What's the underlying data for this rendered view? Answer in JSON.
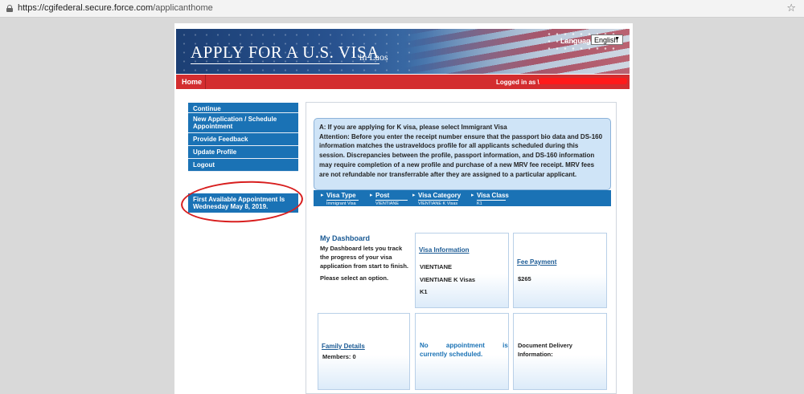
{
  "browser": {
    "url_host": "https://cgifederal.secure.force.com",
    "url_path": "/applicanthome"
  },
  "header": {
    "title": "APPLY FOR A U.S. VISA",
    "country": "in  Laos",
    "language_label": "Language:",
    "language_value": "English"
  },
  "navbar": {
    "home": "Home",
    "logged_in": "Logged in as  \\"
  },
  "sidebar": {
    "items": [
      {
        "label": "Continue"
      },
      {
        "label": "New Application / Schedule Appointment"
      },
      {
        "label": "Provide Feedback"
      },
      {
        "label": "Update Profile"
      },
      {
        "label": "Logout"
      }
    ],
    "appointment": "First Available Appointment Is Wednesday May 8, 2019."
  },
  "notice": {
    "line1": "A: If you are applying for K visa, please select Immigrant Visa",
    "line2": "Attention: Before you enter the receipt number ensure that the passport bio data and DS-160 information matches the ustraveldocs profile for all applicants scheduled during this session. Discrepancies between the profile, passport information, and DS-160 information may require completion of a new profile and purchase of a new MRV fee receipt. MRV fees are not refundable nor transferrable after they are assigned to a particular applicant."
  },
  "visa_bar": [
    {
      "label": "Visa Type",
      "value": "Immigrant Visa"
    },
    {
      "label": "Post",
      "value": "VIENTIANE"
    },
    {
      "label": "Visa Category",
      "value": "VIENTIANE K Visas"
    },
    {
      "label": "Visa Class",
      "value": "K1"
    }
  ],
  "dashboard": {
    "title": "My Dashboard",
    "text": "My Dashboard lets you track the progress of your visa application from start to finish.",
    "prompt": "Please select an option.",
    "visa_info": {
      "title": "Visa Information",
      "post": "VIENTIANE",
      "category": "VIENTIANE K Visas",
      "class": "K1"
    },
    "fee": {
      "title": "Fee Payment",
      "amount": "$265"
    },
    "family": {
      "title": "Family Details",
      "members": "Members: 0"
    },
    "appointment": {
      "line1": "No          appointment          is",
      "line2": "currently scheduled."
    },
    "delivery": {
      "line1": "Document Delivery",
      "line2": "Information:"
    }
  },
  "colors": {
    "nav_blue": "#1a72b5",
    "header_red": "#d32d2f",
    "annotation_red": "#d81e1e"
  }
}
